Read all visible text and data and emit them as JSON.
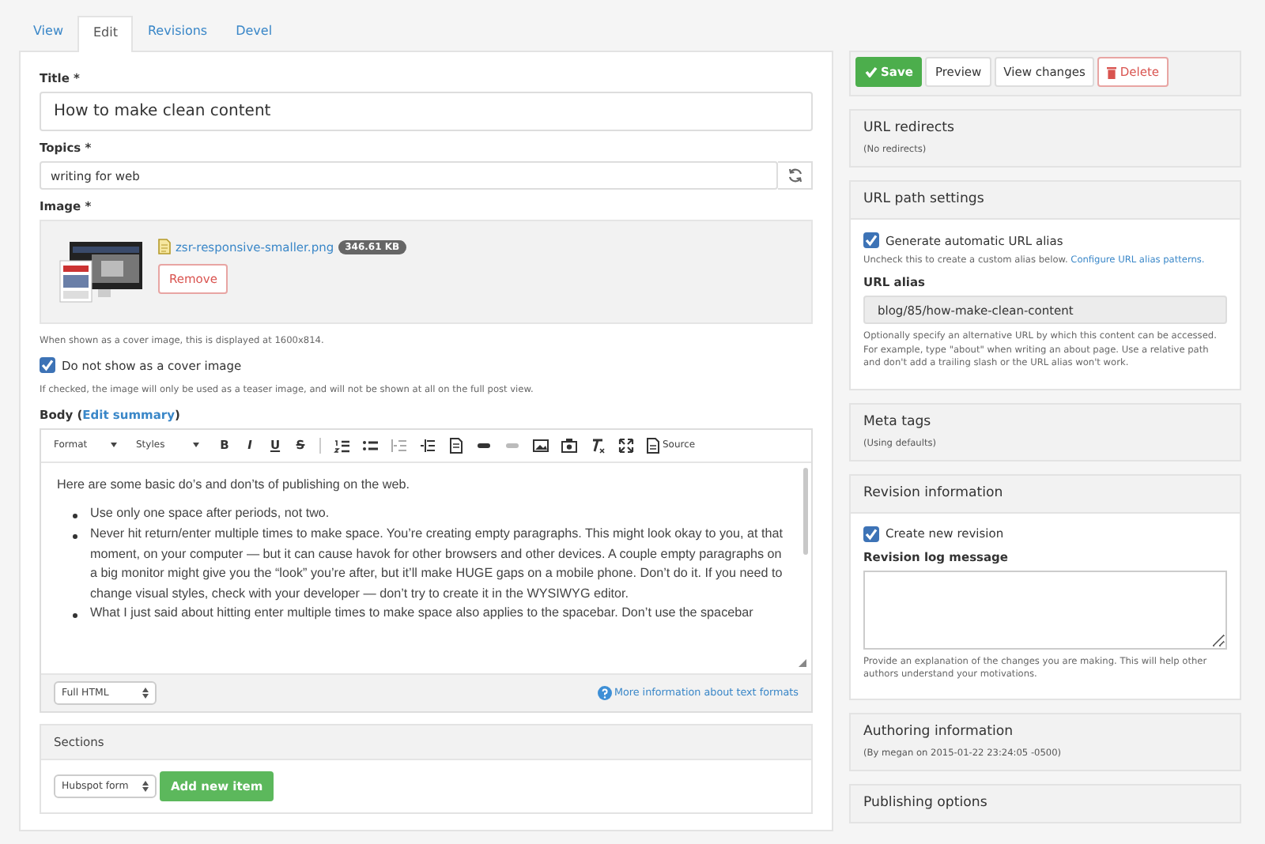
{
  "tabs": [
    {
      "label": "View",
      "selected": false
    },
    {
      "label": "Edit",
      "selected": true
    },
    {
      "label": "Revisions",
      "selected": false
    },
    {
      "label": "Devel",
      "selected": false
    }
  ],
  "title_field": {
    "label": "Title",
    "required": "*",
    "value": "How to make clean content"
  },
  "topics_field": {
    "label": "Topics",
    "required": "*",
    "value": "writing for web"
  },
  "image_field": {
    "label": "Image",
    "required": "*",
    "file_name": "zsr-responsive-smaller.png",
    "file_size": "346.61 KB",
    "remove_button": "Remove",
    "help": "When shown as a cover image, this is displayed at 1600x814."
  },
  "cover_checkbox": {
    "label": "Do not show as a cover image",
    "checked": true,
    "help": "If checked, the image will only be used as a teaser image, and will not be shown at all on the full post view."
  },
  "body_field": {
    "label": "Body (",
    "link": "Edit summary",
    "label_end": ")",
    "toolbar": {
      "format": "Format",
      "styles": "Styles",
      "letters": [
        "B",
        "I",
        "U",
        "S"
      ],
      "source": "Source"
    },
    "intro": "Here are some basic do’s and don’ts of publishing on the web.",
    "bullets": [
      "Use only one space after periods, not two.",
      "Never hit return/enter multiple times to make space. You’re creating empty paragraphs. This might look okay to you, at that moment, on your computer — but it can cause havok for other browsers and other devices. A couple empty paragraphs on a big monitor might give you the “look” you’re after, but it’ll make HUGE gaps on a mobile phone. Don’t do it. If you need to change visual styles, check with your developer — don’t try to create it in the WYSIWYG editor.",
      "What I just said about hitting enter multiple times to make space also applies to the spacebar. Don’t use the spacebar"
    ],
    "text_format": "Full HTML",
    "formats_link": "More information about text formats"
  },
  "sections": {
    "title": "Sections",
    "select": "Hubspot form",
    "add_button": "Add new item"
  },
  "actions": [
    {
      "label": "Save",
      "kind": "primary"
    },
    {
      "label": "Preview",
      "kind": "default"
    },
    {
      "label": "View changes",
      "kind": "default"
    },
    {
      "label": "Delete",
      "kind": "danger"
    }
  ],
  "sidebar_panels": [
    {
      "kind": "summary",
      "title": "URL redirects",
      "summary": "(No redirects)"
    },
    {
      "kind": "url_path",
      "title": "URL path settings",
      "checkbox": {
        "label": "Generate automatic URL alias",
        "checked": true
      },
      "help": "Uncheck this to create a custom alias below.",
      "help_link": "Configure URL alias patterns.",
      "alias_label": "URL alias",
      "alias_value": "blog/85/how-make-clean-content",
      "alias_help": "Optionally specify an alternative URL by which this content can be accessed. For example, type \"about\" when writing an about page. Use a relative path and don't add a trailing slash or the URL alias won't work."
    },
    {
      "kind": "summary",
      "title": "Meta tags",
      "summary": "(Using defaults)"
    },
    {
      "kind": "revision",
      "title": "Revision information",
      "checkbox": {
        "label": "Create new revision",
        "checked": true
      },
      "log_label": "Revision log message",
      "help": "Provide an explanation of the changes you are making. This will help other authors understand your motivations."
    },
    {
      "kind": "summary",
      "title": "Authoring information",
      "summary": "(By megan on 2015-01-22 23:24:05 -0500)"
    },
    {
      "kind": "summary",
      "title": "Publishing options"
    }
  ]
}
